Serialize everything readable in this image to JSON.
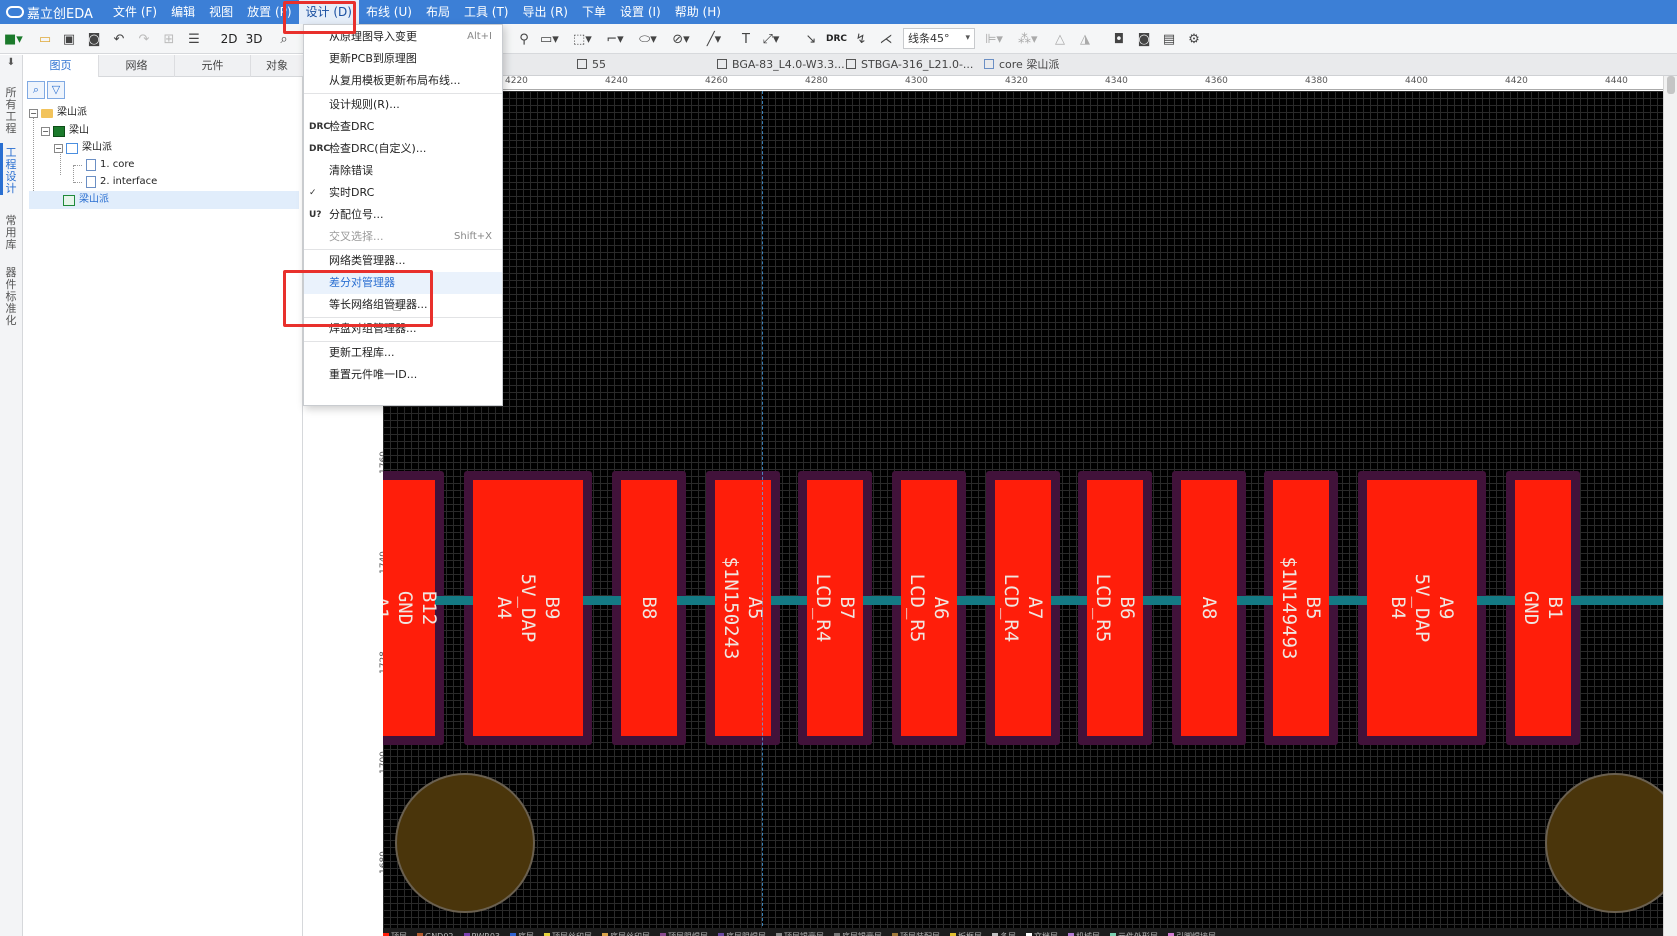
{
  "app": {
    "logo": "嘉立创EDA"
  },
  "menubar": {
    "items": [
      "文件 (F)",
      "编辑",
      "视图",
      "放置 (P)",
      "设计 (D)",
      "布线 (U)",
      "布局",
      "工具 (T)",
      "导出 (R)",
      "下单",
      "设置 (I)",
      "帮助 (H)"
    ]
  },
  "toolbar": {
    "view_2d": "2D",
    "view_3d": "3D",
    "drc_label": "DRC",
    "line_mode": "线条45°"
  },
  "left_strip": {
    "tabs": [
      "所有工程",
      "工程设计",
      "常用库",
      "器件标准化"
    ]
  },
  "panel": {
    "tabs": [
      "图页",
      "网络",
      "元件",
      "对象"
    ],
    "tree": {
      "project": "梁山派",
      "board": "梁山",
      "schematic": "梁山派",
      "page1": "1. core",
      "page2": "2. interface",
      "pcb": "梁山派"
    }
  },
  "doc_tabs": [
    "55",
    "BGA-83_L4.0-W3.3...",
    "STBGA-316_L21.0-...",
    "core 梁山派"
  ],
  "ruler": {
    "h": [
      "4220",
      "4240",
      "4260",
      "4280",
      "4300",
      "4320",
      "4340",
      "4360",
      "4380",
      "4400",
      "4420",
      "4440"
    ],
    "v": [
      "1760",
      "1740",
      "1728",
      "1700",
      "1680"
    ]
  },
  "design_menu": {
    "items": [
      {
        "label": "从原理图导入变更",
        "shortcut": "Alt+I",
        "icon": "",
        "state": "normal"
      },
      {
        "label": "更新PCB到原理图",
        "shortcut": "",
        "icon": "",
        "state": "normal"
      },
      {
        "label": "从复用模板更新布局布线...",
        "shortcut": "",
        "icon": "",
        "state": "normal"
      },
      {
        "label": "设计规则(R)...",
        "shortcut": "",
        "icon": "",
        "state": "normal"
      },
      {
        "label": "检查DRC",
        "shortcut": "",
        "icon": "DRC",
        "state": "normal"
      },
      {
        "label": "检查DRC(自定义)...",
        "shortcut": "",
        "icon": "DRC",
        "state": "normal"
      },
      {
        "label": "清除错误",
        "shortcut": "",
        "icon": "",
        "state": "normal"
      },
      {
        "label": "实时DRC",
        "shortcut": "",
        "icon": "✓",
        "state": "normal"
      },
      {
        "label": "分配位号...",
        "shortcut": "",
        "icon": "U?",
        "state": "normal"
      },
      {
        "label": "交叉选择...",
        "shortcut": "Shift+X",
        "icon": "",
        "state": "disabled"
      },
      {
        "label": "网络类管理器...",
        "shortcut": "",
        "icon": "",
        "state": "normal"
      },
      {
        "label": "差分对管理器",
        "shortcut": "",
        "icon": "",
        "state": "hover"
      },
      {
        "label": "等长网络组管理器...",
        "shortcut": "",
        "icon": "",
        "state": "normal"
      },
      {
        "label": "焊盘对组管理器...",
        "shortcut": "",
        "icon": "",
        "state": "normal"
      },
      {
        "label": "更新工程库...",
        "shortcut": "",
        "icon": "",
        "state": "normal"
      },
      {
        "label": "重置元件唯一ID...",
        "shortcut": "",
        "icon": "",
        "state": "normal"
      }
    ]
  },
  "pads": [
    {
      "pin": "B12",
      "net": "GND",
      "pin2": "A1"
    },
    {
      "pin": "B9",
      "net": "5V_DAP",
      "pin2": "A4"
    },
    {
      "pin": "B8",
      "net": "",
      "pin2": ""
    },
    {
      "pin": "A5",
      "net": "$1N150243",
      "pin2": ""
    },
    {
      "pin": "B7",
      "net": "LCD_R4",
      "pin2": ""
    },
    {
      "pin": "A6",
      "net": "LCD_R5",
      "pin2": ""
    },
    {
      "pin": "A7",
      "net": "LCD_R4",
      "pin2": ""
    },
    {
      "pin": "B6",
      "net": "LCD_R5",
      "pin2": ""
    },
    {
      "pin": "A8",
      "net": "",
      "pin2": ""
    },
    {
      "pin": "B5",
      "net": "$1N149493",
      "pin2": ""
    },
    {
      "pin": "A9",
      "net": "5V_DAP",
      "pin2": "B4"
    },
    {
      "pin": "B1",
      "net": "GND",
      "pin2": ""
    }
  ],
  "layers": [
    "顶层",
    "GND02",
    "PWR03",
    "底层",
    "顶层丝印层",
    "底层丝印层",
    "顶层阻焊层",
    "底层阻焊层",
    "顶层锡膏层",
    "底层锡膏层",
    "顶层装配层",
    "板框层",
    "多层",
    "文档层",
    "机械层",
    "元件外形层",
    "引脚焊接层"
  ],
  "colors": {
    "menubar": "#3c7fd6",
    "pad": "#ff1e0a",
    "trace": "#147a84",
    "annotation": "#e8302c"
  }
}
